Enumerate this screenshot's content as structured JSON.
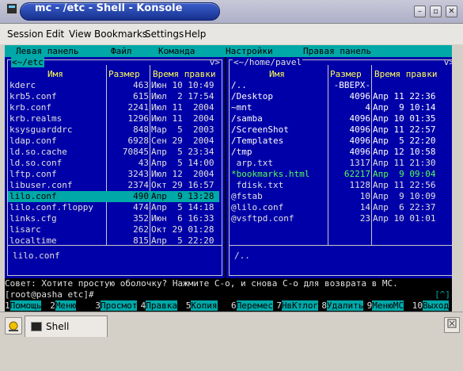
{
  "window": {
    "title": "mc - /etc - Shell - Konsole",
    "btn_min": "–",
    "btn_max": "▫",
    "btn_close": "✕"
  },
  "menu": [
    "Session",
    "Edit",
    "View",
    "Bookmarks",
    "Settings",
    "Help"
  ],
  "mc_menu": [
    "Левая панель",
    "Файл",
    "Команда",
    "Настройки",
    "Правая панель"
  ],
  "left_panel": {
    "path": "<~/etc",
    "path_right": "v>",
    "col_name": "Имя",
    "col_size": "Размер",
    "col_time": "Время правки",
    "rows": [
      {
        "name": "kderc",
        "size": "463",
        "time": "Июн 10 10:49"
      },
      {
        "name": "krb5.conf",
        "size": "615",
        "time": "Июл  2 17:54"
      },
      {
        "name": "krb.conf",
        "size": "2241",
        "time": "Июл 11  2004"
      },
      {
        "name": "krb.realms",
        "size": "1296",
        "time": "Июл 11  2004"
      },
      {
        "name": "ksysguarddrc",
        "size": "848",
        "time": "Мар  5  2003"
      },
      {
        "name": "ldap.conf",
        "size": "6928",
        "time": "Сен 29  2004"
      },
      {
        "name": "ld.so.cache",
        "size": "70845",
        "time": "Апр  5 23:34"
      },
      {
        "name": "ld.so.conf",
        "size": "43",
        "time": "Апр  5 14:00"
      },
      {
        "name": "lftp.conf",
        "size": "3243",
        "time": "Июл 12  2004"
      },
      {
        "name": "libuser.conf",
        "size": "2374",
        "time": "Окт 29 16:57"
      },
      {
        "name": "lilo.conf",
        "size": "490",
        "time": "Апр  9 13:28"
      },
      {
        "name": "lilo.conf.floppy",
        "size": "474",
        "time": "Апр  5 14:18"
      },
      {
        "name": "links.cfg",
        "size": "352",
        "time": "Июн  6 16:33"
      },
      {
        "name": "lisarc",
        "size": "262",
        "time": "Окт 29 01:28"
      },
      {
        "name": "localtime",
        "size": "815",
        "time": "Апр  5 22:20"
      }
    ],
    "selected_index": 10,
    "mini_status": "lilo.conf"
  },
  "right_panel": {
    "path": "<~/home/pavel",
    "path_right": "v>",
    "col_name": "Имя",
    "col_size": "Размер",
    "col_time": "Время правки",
    "rows": [
      {
        "name": "/..",
        "size": "-ВВЕРХ-",
        "time": "",
        "style": "white"
      },
      {
        "name": "/Desktop",
        "size": "4096",
        "time": "Апр 11 22:36",
        "style": "white"
      },
      {
        "name": "~mnt",
        "size": "4",
        "time": "Апр  9 10:14",
        "style": "white"
      },
      {
        "name": "/samba",
        "size": "4096",
        "time": "Апр 10 01:35",
        "style": "white"
      },
      {
        "name": "/ScreenShot",
        "size": "4096",
        "time": "Апр 11 22:57",
        "style": "white"
      },
      {
        "name": "/Templates",
        "size": "4096",
        "time": "Апр  5 22:20",
        "style": "white"
      },
      {
        "name": "/tmp",
        "size": "4096",
        "time": "Апр 12 10:58",
        "style": "white"
      },
      {
        "name": " arp.txt",
        "size": "1317",
        "time": "Апр 11 21:30",
        "style": ""
      },
      {
        "name": "*bookmarks.html",
        "size": "62217",
        "time": "Апр  9 09:04",
        "style": "green"
      },
      {
        "name": " fdisk.txt",
        "size": "1128",
        "time": "Апр 11 22:56",
        "style": ""
      },
      {
        "name": "@fstab",
        "size": "10",
        "time": "Апр  9 10:09",
        "style": ""
      },
      {
        "name": "@lilo.conf",
        "size": "14",
        "time": "Апр  6 22:37",
        "style": ""
      },
      {
        "name": "@vsftpd.conf",
        "size": "23",
        "time": "Апр 10 01:01",
        "style": ""
      }
    ],
    "mini_status": "/.."
  },
  "hint": "Совет: Хотите простую оболочку? Нажмите C-o, и снова C-o для возврата в МС.",
  "prompt": "[root@pasha etc]#",
  "scroll_marker": "[^]",
  "fkeys": [
    {
      "n": "1",
      "label": "Помощь"
    },
    {
      "n": "2",
      "label": "Меню"
    },
    {
      "n": "3",
      "label": "Просмот"
    },
    {
      "n": "4",
      "label": "Правка"
    },
    {
      "n": "5",
      "label": "Копия"
    },
    {
      "n": "6",
      "label": "Перемес"
    },
    {
      "n": "7",
      "label": "НвКтлог"
    },
    {
      "n": "8",
      "label": "Удалить"
    },
    {
      "n": "9",
      "label": "МенюМС"
    },
    {
      "n": "10",
      "label": "Выход"
    }
  ],
  "tabs": [
    {
      "label": "Shell"
    }
  ],
  "colors": {
    "panel_bg": "#0000a8",
    "accent_cyan": "#00a8a8",
    "header_yellow": "#ffff54",
    "exec_green": "#54ff54",
    "title_blue": "#17328f"
  }
}
